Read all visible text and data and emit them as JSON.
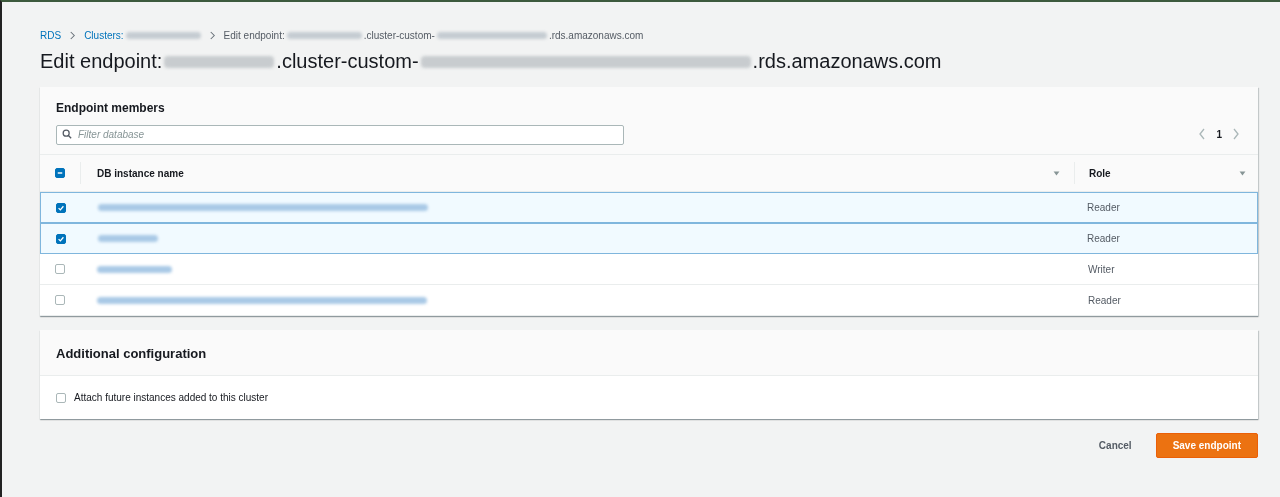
{
  "breadcrumb": [
    {
      "kind": "link",
      "parts": [
        {
          "kind": "text",
          "text": "RDS"
        }
      ]
    },
    {
      "kind": "link",
      "parts": [
        {
          "kind": "text",
          "text": "Clusters:"
        },
        {
          "kind": "redacted_m"
        }
      ]
    },
    {
      "kind": "current",
      "parts": [
        {
          "kind": "text",
          "text": "Edit endpoint:"
        },
        {
          "kind": "redacted_m"
        },
        {
          "kind": "text",
          "text": ".cluster-custom-"
        },
        {
          "kind": "redacted_l"
        },
        {
          "kind": "text",
          "text": ".rds.amazonaws.com"
        }
      ]
    }
  ],
  "page_title": [
    {
      "kind": "text",
      "text": "Edit endpoint:"
    },
    {
      "kind": "redacted_l"
    },
    {
      "kind": "text",
      "text": ".cluster-custom-"
    },
    {
      "kind": "redacted_xxl"
    },
    {
      "kind": "text",
      "text": ".rds.amazonaws.com"
    }
  ],
  "members": {
    "title": "Endpoint members",
    "search": {
      "placeholder": "Filter database"
    },
    "pagination": {
      "page": "1"
    },
    "select_all": {
      "checked": true,
      "partial": true
    },
    "columns": [
      {
        "label": "DB instance name"
      },
      {
        "label": "Role"
      }
    ],
    "rows": [
      {
        "name": {
          "kind": "redacted_xxl"
        },
        "role": "Reader",
        "selected": true
      },
      {
        "name": {
          "kind": "redacted_s"
        },
        "role": "Reader",
        "selected": true
      },
      {
        "name": {
          "kind": "redacted_m"
        },
        "role": "Writer",
        "selected": false
      },
      {
        "name": {
          "kind": "redacted_xxl"
        },
        "role": "Reader",
        "selected": false
      }
    ]
  },
  "additional": {
    "title": "Additional configuration",
    "option": {
      "label": "Attach future instances added to this cluster",
      "checked": false
    }
  },
  "buttons": [
    {
      "kind": "link",
      "label": "Cancel"
    },
    {
      "kind": "primary",
      "label": "Save endpoint"
    }
  ]
}
